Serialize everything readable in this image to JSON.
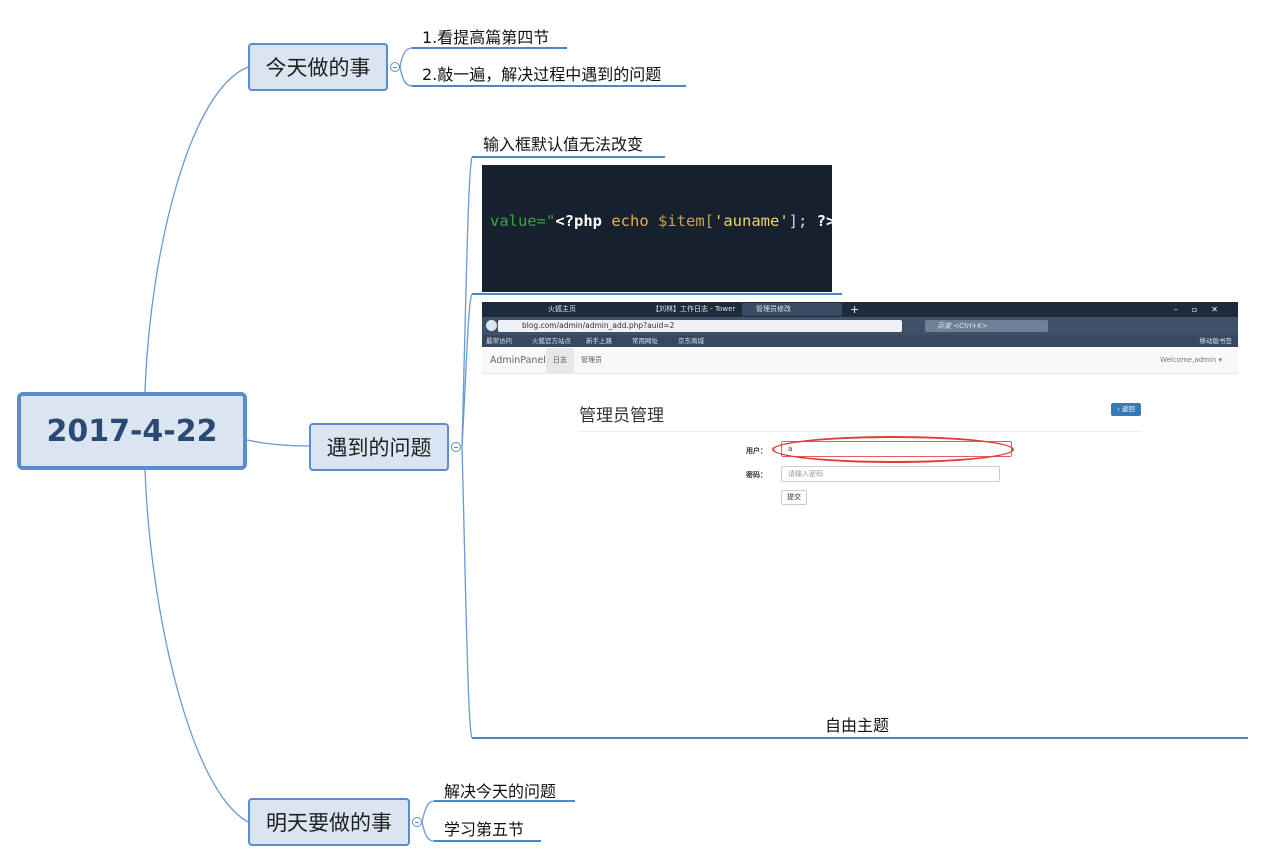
{
  "root": {
    "label": "2017-4-22"
  },
  "branches": {
    "today": {
      "label": "今天做的事",
      "items": [
        "1.看提高篇第四节",
        "2.敲一遍，解决过程中遇到的问题"
      ]
    },
    "problems": {
      "label": "遇到的问题",
      "item_title": "输入框默认值无法改变",
      "code": {
        "p1": "value=\"",
        "p2": "<?php",
        "p3": " echo ",
        "p4": "$item[",
        "p5": "'auname'",
        "p6": "]; ",
        "p7": "?>"
      },
      "floating_label": "自由主题"
    },
    "tomorrow": {
      "label": "明天要做的事",
      "items": [
        "解决今天的问题",
        "学习第五节"
      ]
    }
  },
  "screenshot": {
    "tabs": [
      "火狐主页",
      "【刘林】工作日志 - Tower",
      "管理员修改"
    ],
    "url": "blog.com/admin/admin_add.php?auid=2",
    "search_placeholder": "百度 <Ctrl+K>",
    "bookmarks": [
      "最常访问",
      "火狐官方站点",
      "新手上路",
      "常用网址",
      "京东商城"
    ],
    "mobile_bookmarks": "移动版书签",
    "navbar": {
      "brand": "AdminPanel",
      "tabs": [
        "日志",
        "管理员"
      ],
      "welcome": "Welcome,admin ▾"
    },
    "page_title": "管理员管理",
    "back_label": "‹ 返回",
    "form": {
      "user_label": "用户：",
      "user_value": "a",
      "password_label": "密码：",
      "password_placeholder": "请输入密码",
      "submit_label": "提交"
    }
  },
  "colors": {
    "topic_fill": "#dbe5f1",
    "topic_border": "#5b8dca",
    "line": "#5b8dca",
    "highlight": "#e33b3b"
  }
}
